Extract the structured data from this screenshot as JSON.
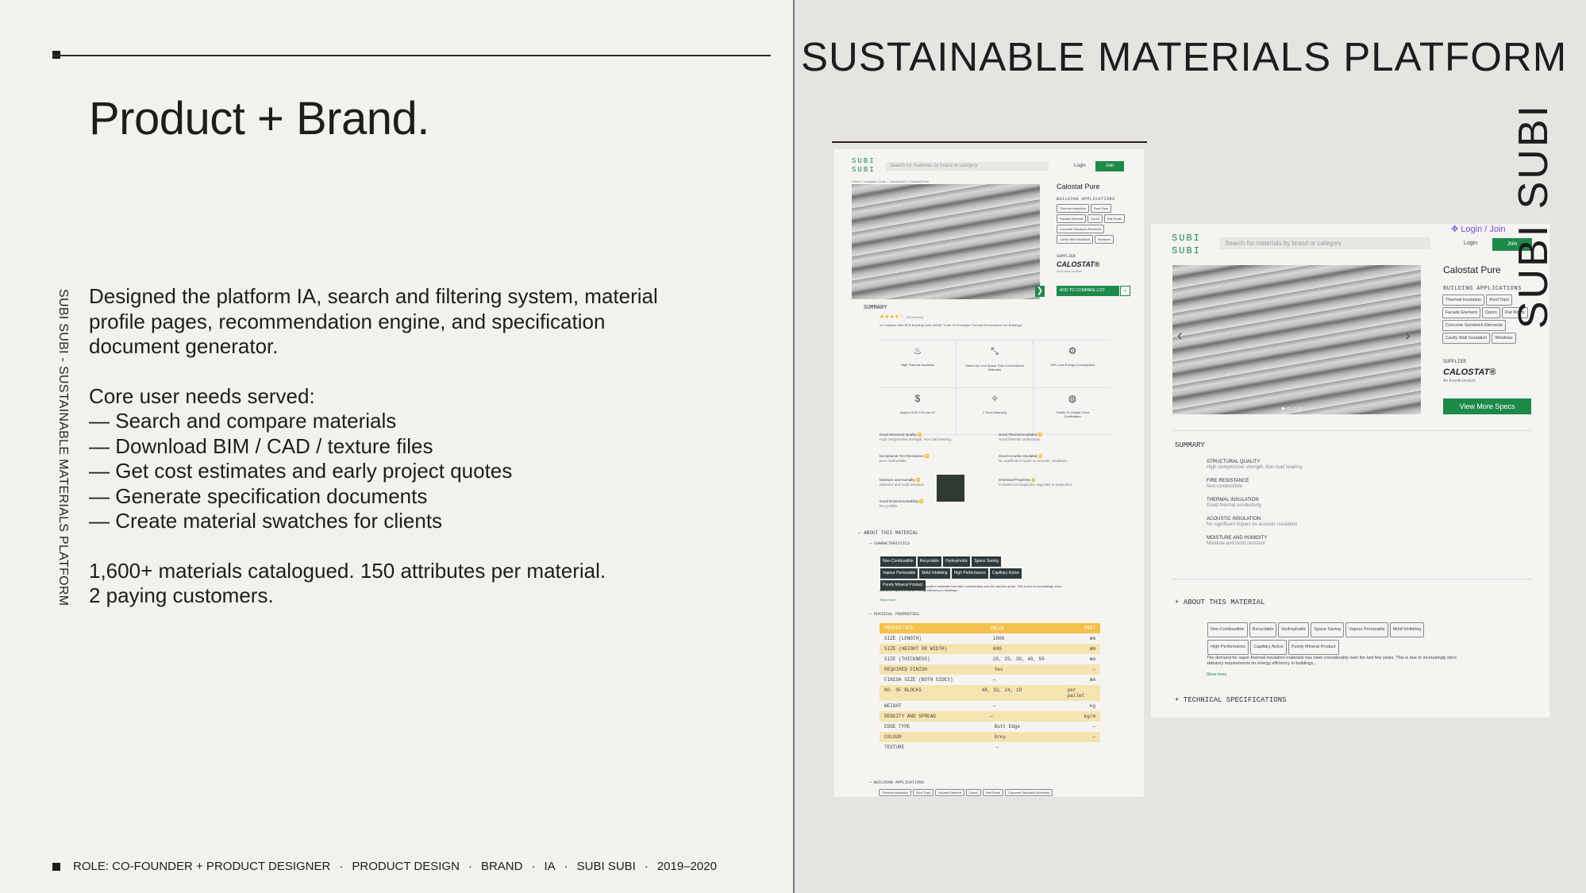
{
  "left": {
    "headline": "Product + Brand.",
    "vertical_label": "SUBI SUBI - SUSTAINABLE MATERIALS PLATFORM",
    "intro": "Designed the platform IA, search and filtering system, material profile pages, recommendation engine, and specification document generator.",
    "needs_title": "Core user needs served:",
    "needs": [
      "— Search and compare materials",
      "— Download BIM / CAD / texture files",
      "— Get cost estimates and early project quotes",
      "— Generate specification documents",
      "— Create material swatches for clients"
    ],
    "stats_line1": "1,600+ materials catalogued.  150 attributes per material.",
    "stats_line2": "2 paying customers.",
    "footer": {
      "role": "ROLE: CO-FOUNDER + PRODUCT DESIGNER",
      "items": [
        "PRODUCT DESIGN",
        "BRAND",
        "IA",
        "SUBI SUBI",
        "2019–2020"
      ],
      "separator": "·"
    }
  },
  "right": {
    "title": "SUSTAINABLE MATERIALS PLATFORM",
    "vertical_brand": "SUBI SUBI"
  },
  "screen1": {
    "logo_line1": "SUBI",
    "logo_line2": "SUBI",
    "search_placeholder": "Search for materials by brand or category",
    "login": "Login",
    "join": "Join",
    "breadcrumb": "Home  >  Insulation Units  >  Calostat AG  >  Calostat Pure",
    "product_name": "Calostat Pure",
    "building_applications_label": "BUILDING APPLICATIONS",
    "applications": [
      "Thermal Insulation",
      "Roof Tops",
      "Facade Element",
      "Doors",
      "Flat Roofs",
      "Concrete Sandwich Elements",
      "Cavity Wall Insulation",
      "Windows"
    ],
    "supplier_label": "SUPPLIER",
    "supplier": "CALOSTAT®",
    "supplier_sub": "An Evonik product",
    "compare_button": "ADD TO COMPARE LIST",
    "summary_label": "SUMMARY",
    "reviews": "(79 reviews)",
    "compliance": "Complies With BCA Building Code (2008) \"Code On Envelope Thermal Performance For Buildings\"",
    "features": [
      "High Thermal Insulation",
      "Takes Up Less Space Than Conventional Materials",
      "15% Less Energy Consumption",
      "Approx SGD 3.00 per m²",
      "2 Years Warranty",
      "Credits To Credits Good Certification"
    ],
    "qualities": [
      {
        "t": "Good Structural Quality",
        "d": "High compressive strength. Non load bearing."
      },
      {
        "t": "Good Thermal Insulation",
        "d": "Good thermal conductivity."
      },
      {
        "t": "Exceptional Fire Resistance",
        "d": "Non-combustible"
      },
      {
        "t": "Good Acoustic Insulation",
        "d": "No significant impact on acoustic insulation."
      },
      {
        "t": "Moisture and Humidity",
        "d": "Moisture and mold resistant."
      },
      {
        "t": "Chemical Properties",
        "d": "Contains no fungicides, algicides or pesticides."
      },
      {
        "t": "Good Environmentability",
        "d": "Recyclable"
      }
    ],
    "about_label": "ABOUT THIS MATERIAL",
    "characteristics_label": "CHARACTERISTICS",
    "characteristics": [
      "Non-Combustible",
      "Recyclable",
      "Hydrophobic",
      "Space Saving",
      "Vapour Permeable",
      "Mold Inhibiting",
      "High Performance",
      "Capillary Active",
      "Purely Mineral Product"
    ],
    "about_text": "The demand for super thermal insulation materials has risen considerably over the last few years. This is due to increasingly strict statutory requirements on energy efficiency in buildings...",
    "show_more": "Show more",
    "physical_label": "PHYSICAL PROPERTIES",
    "table_head": [
      "PROPERTIES",
      "VALUE",
      "UNIT"
    ],
    "table_rows": [
      [
        "SIZE (LENGTH)",
        "1000",
        "mm"
      ],
      [
        "SIZE (HEIGHT OR WIDTH)",
        "600",
        "mm"
      ],
      [
        "SIZE (THICKNESS)",
        "20, 25, 30, 40, 50",
        "mm"
      ],
      [
        "REQUIRED FINISH",
        "Yes",
        "—"
      ],
      [
        "FINISH SIZE (BOTH SIDES)",
        "—",
        "mm"
      ],
      [
        "NO. OF BLOCKS",
        "48, 32, 24, 19",
        "per pallet"
      ],
      [
        "WEIGHT",
        "—",
        "kg"
      ],
      [
        "DENSITY AND SPREAD",
        "—",
        "kg/m"
      ],
      [
        "EDGE TYPE",
        "Butt Edge",
        "—"
      ],
      [
        "COLOUR",
        "Grey",
        "—"
      ],
      [
        "TEXTURE",
        "—",
        ""
      ]
    ],
    "building_apps_bottom": "BUILDING APPLICATIONS",
    "bottom_tags": [
      "Thermal Insulation",
      "Roof Tops",
      "Facade Element",
      "Doors",
      "Flat Roofs",
      "Concrete Sandwich Elements"
    ]
  },
  "screen2": {
    "logo_line1": "SUBI",
    "logo_line2": "SUBI",
    "login_join_link": "Login / Join",
    "search_placeholder": "Search for materials by brand or category",
    "login": "Login",
    "join": "Join",
    "product_name": "Calostat Pure",
    "building_applications_label": "BUILDING APPLICATIONS",
    "applications": [
      "Thermal Insulation",
      "Roof Tops",
      "Facade Element",
      "Doors",
      "Flat Roofs",
      "Concrete Sandwich Elements",
      "Cavity Wall Insulation",
      "Windows"
    ],
    "supplier_label": "SUPPLIER",
    "supplier": "CALOSTAT®",
    "supplier_sub": "An Evonik product",
    "specs_button": "View More Specs",
    "summary_label": "SUMMARY",
    "summary_items": [
      {
        "t": "STRUCTURAL QUALITY",
        "d": "High compressive strength. Non load bearing."
      },
      {
        "t": "FIRE RESISTANCE",
        "d": "Non-combustible"
      },
      {
        "t": "THERMAL INSULATION",
        "d": "Good thermal conductivity"
      },
      {
        "t": "ACOUSTIC INSULATION",
        "d": "No significant impact on acoustic insulation"
      },
      {
        "t": "MOISTURE AND HUMIDITY",
        "d": "Moisture and mold resistant"
      }
    ],
    "about_label": "+ ABOUT THIS MATERIAL",
    "characteristics": [
      "Non-Combustible",
      "Recyclable",
      "Hydrophobic",
      "Space Saving",
      "Vapour Permeable",
      "Mold Inhibiting",
      "High Performance",
      "Capillary Active",
      "Purely Mineral Product"
    ],
    "about_text": "The demand for super thermal insulation materials has risen considerably over the last few years. This is due to increasingly strict statutory requirements on energy efficiency in buildings...",
    "show_more": "Show more",
    "tech_label": "+ TECHNICAL SPECIFICATIONS"
  }
}
